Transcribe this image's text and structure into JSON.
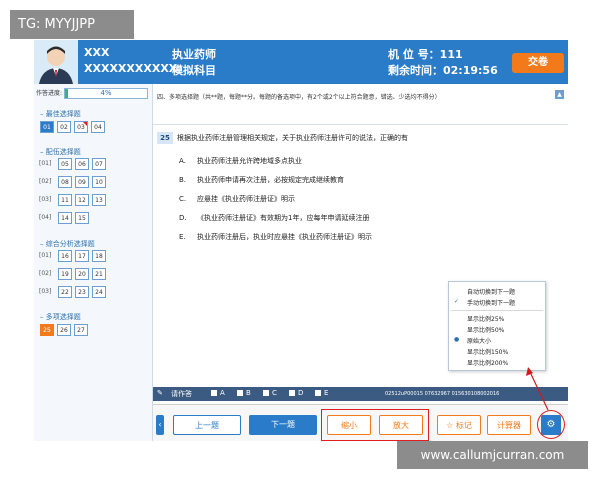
{
  "watermark_top": "TG: MYYJJPP",
  "watermark_bottom": "www.callumjcurran.com",
  "header": {
    "name": "XXX",
    "id": "XXXXXXXXXXX",
    "subject": "执业药师",
    "subject_sub": "模拟科目",
    "seat_label": "机  位  号：111",
    "time_label": "剩余时间：02:19:56",
    "submit": "交卷"
  },
  "sidebar": {
    "progress_label": "作答进度:",
    "progress_text": "4%",
    "progress_value": 0.04,
    "sections": [
      {
        "title": "最佳选择题",
        "rows": [
          {
            "label": "",
            "buttons": [
              "01",
              "02",
              "03",
              "04"
            ]
          }
        ]
      },
      {
        "title": "配伍选择题",
        "rows": [
          {
            "label": "[01]",
            "buttons": [
              "05",
              "06",
              "07"
            ]
          },
          {
            "label": "[02]",
            "buttons": [
              "08",
              "09",
              "10"
            ]
          },
          {
            "label": "[03]",
            "buttons": [
              "11",
              "12",
              "13"
            ]
          },
          {
            "label": "[04]",
            "buttons": [
              "14",
              "15"
            ]
          }
        ]
      },
      {
        "title": "综合分析选择题",
        "rows": [
          {
            "label": "[01]",
            "buttons": [
              "16",
              "17",
              "18"
            ]
          },
          {
            "label": "[02]",
            "buttons": [
              "19",
              "20",
              "21"
            ]
          },
          {
            "label": "[03]",
            "buttons": [
              "22",
              "23",
              "24"
            ]
          }
        ]
      },
      {
        "title": "多项选择题",
        "rows": [
          {
            "label": "",
            "buttons": [
              "25",
              "26",
              "27"
            ]
          }
        ]
      }
    ]
  },
  "main": {
    "instruction": "四、多项选择题（共**题，每题**分。每题的备选项中，有2个或2个以上符合题意，错选、少选均不得分）",
    "question_number": "25",
    "question_stem": "根据执业药师注册管理相关规定，关于执业药师注册许可的说法，正确的有",
    "options": [
      {
        "letter": "A.",
        "text": "执业药师注册允许跨地域多点执业"
      },
      {
        "letter": "B.",
        "text": "执业药师申请再次注册，必按规定完成继续教育"
      },
      {
        "letter": "C.",
        "text": "应悬挂《执业药师注册证》明示"
      },
      {
        "letter": "D.",
        "text": "《执业药师注册证》有效期为1年，应每年申请延续注册"
      },
      {
        "letter": "E.",
        "text": "执业药师注册后，执业时应悬挂《执业药师注册证》明示"
      }
    ],
    "answer_label": "请作答",
    "answer_options": [
      "A",
      "B",
      "C",
      "D",
      "E"
    ],
    "footer_code": "02512uP00015   07632967 015630108002016"
  },
  "nav": {
    "prev": "上一题",
    "next": "下一题",
    "zoom_out": "缩小",
    "zoom_in": "放大",
    "mark": "标记",
    "calculator": "计算器"
  },
  "menu": {
    "items": [
      {
        "label": "自动切换到下一题",
        "mark": ""
      },
      {
        "label": "手动切换到下一题",
        "mark": "✓"
      },
      {
        "label": "显示比例25%",
        "mark": ""
      },
      {
        "label": "显示比例50%",
        "mark": ""
      },
      {
        "label": "原始大小",
        "mark": "●"
      },
      {
        "label": "显示比例150%",
        "mark": ""
      },
      {
        "label": "显示比例200%",
        "mark": ""
      }
    ]
  },
  "colors": {
    "accent": "#2a7cc8",
    "orange": "#f27a1a",
    "highlight_red": "#e02020"
  }
}
